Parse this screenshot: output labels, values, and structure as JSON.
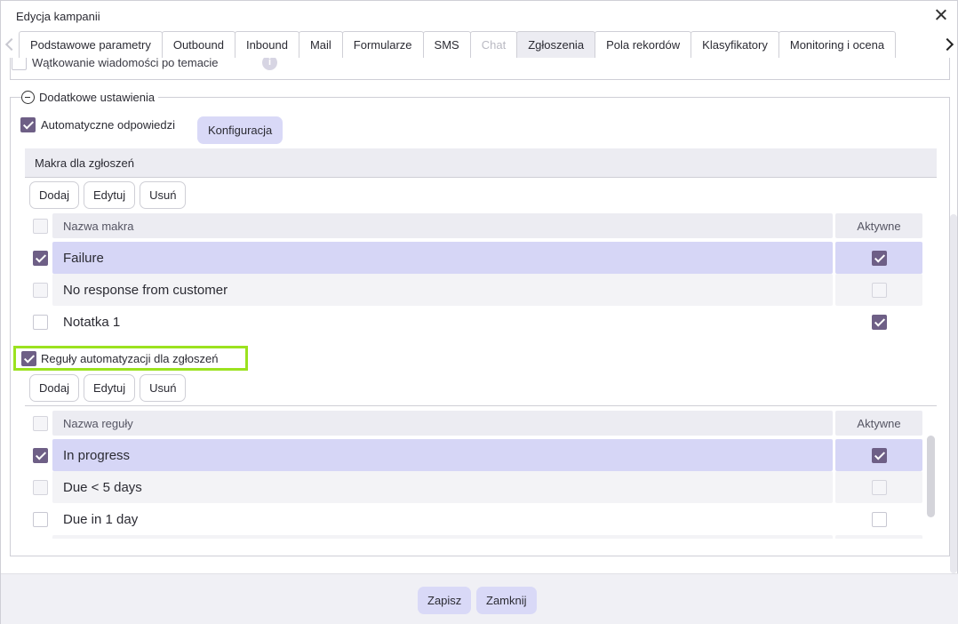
{
  "window": {
    "title": "Edycja kampanii"
  },
  "tabs": [
    {
      "label": "Podstawowe parametry"
    },
    {
      "label": "Outbound"
    },
    {
      "label": "Inbound"
    },
    {
      "label": "Mail"
    },
    {
      "label": "Formularze"
    },
    {
      "label": "SMS"
    },
    {
      "label": "Chat",
      "disabled": true
    },
    {
      "label": "Zgłoszenia",
      "active": true
    },
    {
      "label": "Pola rekordów"
    },
    {
      "label": "Klasyfikatory"
    },
    {
      "label": "Monitoring i ocena"
    }
  ],
  "previous_section": {
    "threading_label": "Wątkowanie wiadomości po temacie",
    "threading_checked": false
  },
  "additional": {
    "legend": "Dodatkowe ustawienia",
    "auto_replies_label": "Automatyczne odpowiedzi",
    "auto_replies_checked": true,
    "configure_button": "Konfiguracja",
    "macros_header": "Makra dla zgłoszeń",
    "macros_buttons": {
      "add": "Dodaj",
      "edit": "Edytuj",
      "delete": "Usuń"
    },
    "macros_columns": {
      "name": "Nazwa makra",
      "active": "Aktywne"
    },
    "macros": [
      {
        "name": "Failure",
        "selected": true,
        "active": true
      },
      {
        "name": "No response from customer",
        "selected": false,
        "active": false
      },
      {
        "name": "Notatka 1",
        "selected": false,
        "active": true
      }
    ],
    "rules_label": "Reguły automatyzacji dla zgłoszeń",
    "rules_checked": true,
    "rules_buttons": {
      "add": "Dodaj",
      "edit": "Edytuj",
      "delete": "Usuń"
    },
    "rules_columns": {
      "name": "Nazwa reguły",
      "active": "Aktywne"
    },
    "rules": [
      {
        "name": "In progress",
        "selected": true,
        "active": true
      },
      {
        "name": "Due < 5 days",
        "selected": false,
        "active": false
      },
      {
        "name": "Due in 1 day",
        "selected": false,
        "active": false
      }
    ]
  },
  "footer": {
    "save": "Zapisz",
    "close": "Zamknij"
  },
  "colors": {
    "accent": "#6e5f86",
    "button": "#d9d9f7",
    "highlight": "#9be21f"
  }
}
